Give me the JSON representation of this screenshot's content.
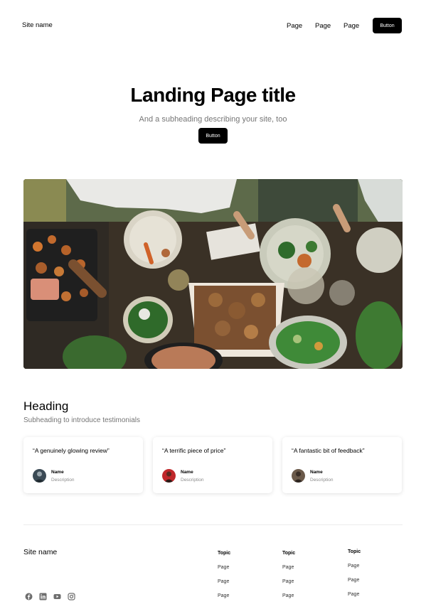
{
  "header": {
    "site_name": "Site name",
    "nav_links": [
      "Page",
      "Page",
      "Page"
    ],
    "button_label": "Button"
  },
  "hero": {
    "title": "Landing Page title",
    "subtitle": "And a subheading describing your site, too",
    "button_label": "Button"
  },
  "testimonials": {
    "heading": "Heading",
    "subheading": "Subheading to introduce testimonials",
    "cards": [
      {
        "quote": "“A genuinely glowing review”",
        "name": "Name",
        "description": "Description"
      },
      {
        "quote": "“A terrific piece of price”",
        "name": "Name",
        "description": "Description"
      },
      {
        "quote": "“A fantastic bit of feedback”",
        "name": "Name",
        "description": "Description"
      }
    ]
  },
  "footer": {
    "site_name": "Site name",
    "social_icons": [
      "facebook-icon",
      "linkedin-icon",
      "youtube-icon",
      "instagram-icon"
    ],
    "columns": [
      {
        "title": "Topic",
        "links": [
          "Page",
          "Page",
          "Page"
        ]
      },
      {
        "title": "Topic",
        "links": [
          "Page",
          "Page",
          "Page"
        ]
      },
      {
        "title": "Topic",
        "links": [
          "Page",
          "Page",
          "Page"
        ]
      }
    ]
  },
  "colors": {
    "primary": "#000000",
    "muted_text": "#757575",
    "background": "#ffffff"
  }
}
